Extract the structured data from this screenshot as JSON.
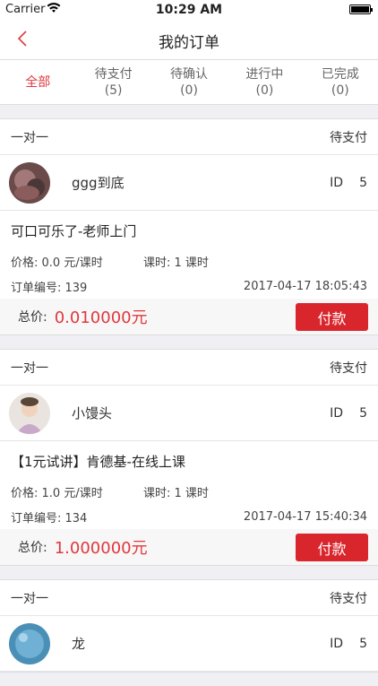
{
  "status_bar": {
    "carrier": "Carrier",
    "time": "10:29 AM"
  },
  "navbar": {
    "title": "我的订单"
  },
  "tabs": [
    {
      "label": "全部",
      "count": ""
    },
    {
      "label": "待支付",
      "count": "(5)"
    },
    {
      "label": "待确认",
      "count": "(0)"
    },
    {
      "label": "进行中",
      "count": "(0)"
    },
    {
      "label": "已完成",
      "count": "(0)"
    }
  ],
  "orders": [
    {
      "type": "一对一",
      "status": "待支付",
      "user": "ggg到底",
      "id_label": "ID",
      "id_value": "5",
      "course": "可口可乐了-老师上门",
      "price": "价格: 0.0 元/课时",
      "hours": "课时: 1 课时",
      "order_no": "订单编号: 139",
      "date": "2017-04-17 18:05:43",
      "total_label": "总价:",
      "total": "0.010000元",
      "pay": "付款"
    },
    {
      "type": "一对一",
      "status": "待支付",
      "user": "小馒头",
      "id_label": "ID",
      "id_value": "5",
      "course": "【1元试讲】肯德基-在线上课",
      "price": "价格: 1.0 元/课时",
      "hours": "课时: 1 课时",
      "order_no": "订单编号: 134",
      "date": "2017-04-17 15:40:34",
      "total_label": "总价:",
      "total": "1.000000元",
      "pay": "付款"
    },
    {
      "type": "一对一",
      "status": "待支付",
      "user": "龙",
      "id_label": "ID",
      "id_value": "5"
    }
  ]
}
